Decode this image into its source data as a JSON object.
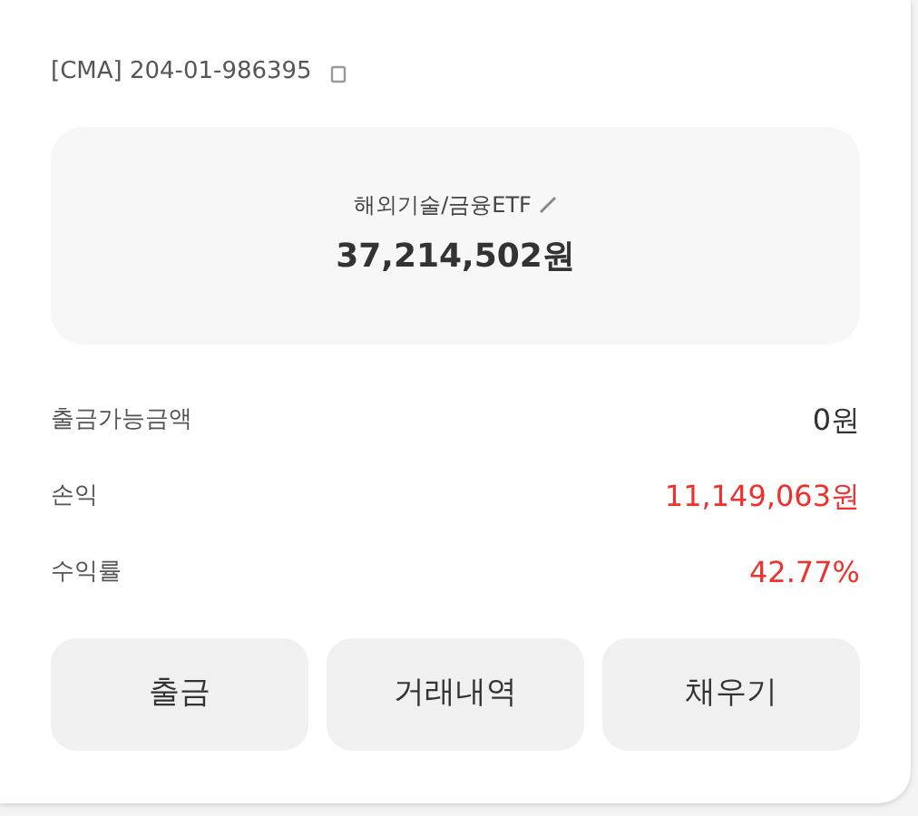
{
  "account": {
    "number": "[CMA] 204-01-986395"
  },
  "balance": {
    "name": "해외기술/금융ETF",
    "amount": "37,214,502원"
  },
  "rows": [
    {
      "label": "출금가능금액",
      "value": "0원",
      "color": "#333333"
    },
    {
      "label": "손익",
      "value": "11,149,063원",
      "color": "#f0302c"
    },
    {
      "label": "수익률",
      "value": "42.77%",
      "color": "#f0302c"
    }
  ],
  "buttons": [
    "출금",
    "거래내역",
    "채우기"
  ]
}
